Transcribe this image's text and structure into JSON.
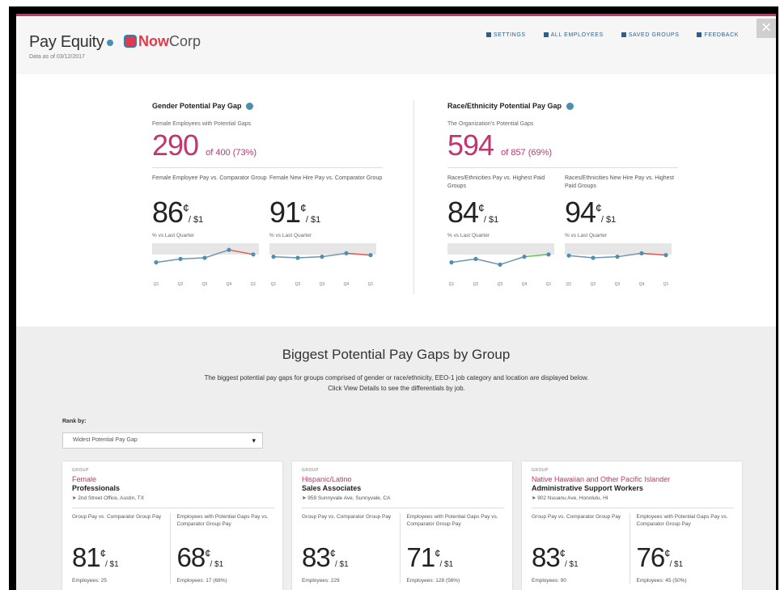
{
  "header": {
    "app_title": "Pay Equity",
    "logo_now": "Now",
    "logo_corp": "Corp",
    "data_date": "Data as of 03/12/2017",
    "nav": [
      {
        "label": "SETTINGS",
        "icon": "gear-icon"
      },
      {
        "label": "ALL EMPLOYEES",
        "icon": "people-icon"
      },
      {
        "label": "SAVED GROUPS",
        "icon": "bookmark-icon"
      },
      {
        "label": "FEEDBACK",
        "icon": "chat-icon"
      }
    ],
    "close": "×"
  },
  "gender": {
    "title": "Gender Potential Pay Gap",
    "subtitle": "Female Employees with Potential Gaps",
    "count": "290",
    "of_text": "of 400 (73%)",
    "metrics": [
      {
        "label": "Female Employee Pay vs. Comparator Group",
        "value": "86",
        "per": "/ $1",
        "spark_label": "% vs Last Quarter",
        "points": [
          0.3,
          0.45,
          0.5,
          0.85,
          0.65
        ],
        "trend_color": "#e0564f"
      },
      {
        "label": "Female New Hire Pay vs. Comparator Group",
        "value": "91",
        "per": "/ $1",
        "spark_label": "% vs Last Quarter",
        "points": [
          0.55,
          0.5,
          0.55,
          0.7,
          0.62
        ],
        "trend_color": "#e0564f"
      }
    ],
    "quarters": [
      "Q1",
      "Q2",
      "Q3",
      "Q4",
      "Q1"
    ]
  },
  "race": {
    "title": "Race/Ethnicity Potential Pay Gap",
    "subtitle": "The Organization's Potential Gaps",
    "count": "594",
    "of_text": "of 857 (69%)",
    "metrics": [
      {
        "label": "Races/Ethnicities Pay vs. Highest Paid Groups",
        "value": "84",
        "per": "/ $1",
        "spark_label": "% vs Last Quarter",
        "points": [
          0.3,
          0.45,
          0.2,
          0.55,
          0.65
        ],
        "trend_color": "#59c24a"
      },
      {
        "label": "Races/Ethnicities New Hire Pay vs. Highest Paid Groups",
        "value": "94",
        "per": "/ $1",
        "spark_label": "% vs Last Quarter",
        "points": [
          0.6,
          0.5,
          0.55,
          0.7,
          0.62
        ],
        "trend_color": "#e0564f"
      }
    ],
    "quarters": [
      "Q1",
      "Q2",
      "Q3",
      "Q4",
      "Q1"
    ]
  },
  "groups_section": {
    "title": "Biggest Potential Pay Gaps by Group",
    "desc_line1": "The biggest potential pay gaps for groups comprised of gender or race/ethnicity, EEO-1 job category and location are displayed below.",
    "desc_line2": "Click View Details to see the differentials by job.",
    "rank_label": "Rank by:",
    "rank_value": "Widest Potential Pay Gap",
    "cards": [
      {
        "tag": "GROUP",
        "group": "Female",
        "job": "Professionals",
        "location": "2nd Street Office, Austin, TX",
        "label1": "Group Pay vs. Comparator Group Pay",
        "value1": "81",
        "foot1": "Employees: 25",
        "label2": "Employees with Potential Gaps Pay vs. Comparator Group Pay",
        "value2": "68",
        "foot2": "Employees: 17 (68%)",
        "per": "/ $1"
      },
      {
        "tag": "GROUP",
        "group": "Hispanic/Latino",
        "job": "Sales Associates",
        "location": "959 Sunnyvale Ave, Sunnyvale, CA",
        "label1": "Group Pay vs. Comparator Group Pay",
        "value1": "83",
        "foot1": "Employees: 229",
        "label2": "Employees with Potential Gaps Pay vs. Comparator Group Pay",
        "value2": "71",
        "foot2": "Employees: 128 (56%)",
        "per": "/ $1"
      },
      {
        "tag": "GROUP",
        "group": "Native Hawaiian and Other Pacific Islander",
        "job": "Administrative Support Workers",
        "location": "902 Nuuanu Ave, Honolulu, HI",
        "label1": "Group Pay vs. Comparator Group Pay",
        "value1": "83",
        "foot1": "Employees: 90",
        "label2": "Employees with Potential Gaps Pay vs. Comparator Group Pay",
        "value2": "76",
        "foot2": "Employees: 45 (50%)",
        "per": "/ $1"
      }
    ]
  },
  "cent": "¢"
}
